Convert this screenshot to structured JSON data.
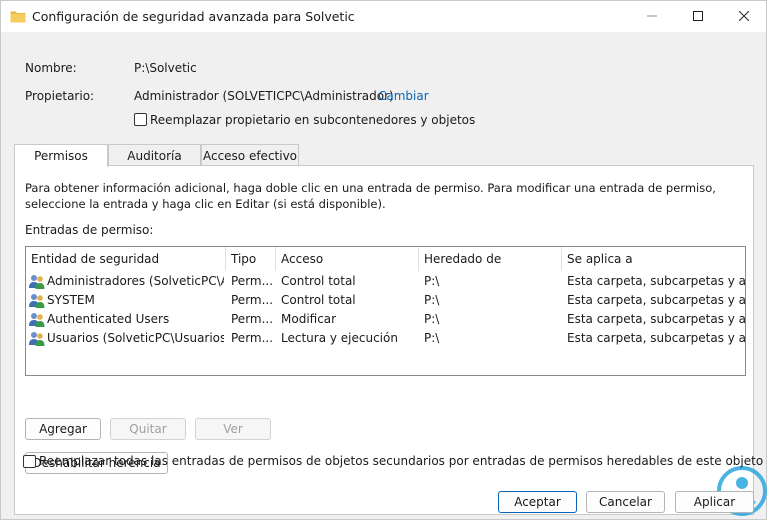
{
  "window": {
    "title": "Configuración de seguridad avanzada para Solvetic",
    "icon": "folder-icon",
    "controls": [
      "minimize-icon",
      "maximize-icon",
      "close-icon"
    ]
  },
  "header": {
    "name_label": "Nombre:",
    "name_value": "P:\\Solvetic",
    "owner_label": "Propietario:",
    "owner_value": "Administrador (SOLVETICPC\\Administrador)",
    "change_link": "Cambiar",
    "replace_owner_label": "Reemplazar propietario en subcontenedores y objetos"
  },
  "tabs": [
    {
      "label": "Permisos",
      "active": true
    },
    {
      "label": "Auditoría",
      "active": false
    },
    {
      "label": "Acceso efectivo",
      "active": false
    }
  ],
  "permisos": {
    "info": "Para obtener información adicional, haga doble clic en una entrada de permiso. Para modificar una entrada de permiso, seleccione la entrada y haga clic en Editar (si está disponible).",
    "entries_label": "Entradas de permiso:",
    "columns": [
      "Entidad de seguridad",
      "Tipo",
      "Acceso",
      "Heredado de",
      "Se aplica a"
    ],
    "rows": [
      {
        "entity": "Administradores (SolveticPC\\A...",
        "type": "Perm...",
        "access": "Control total",
        "inherited": "P:\\",
        "applies": "Esta carpeta, subcarpetas y arc..."
      },
      {
        "entity": "SYSTEM",
        "type": "Perm...",
        "access": "Control total",
        "inherited": "P:\\",
        "applies": "Esta carpeta, subcarpetas y arc..."
      },
      {
        "entity": "Authenticated Users",
        "type": "Perm...",
        "access": "Modificar",
        "inherited": "P:\\",
        "applies": "Esta carpeta, subcarpetas y arc..."
      },
      {
        "entity": "Usuarios (SolveticPC\\Usuarios)",
        "type": "Perm...",
        "access": "Lectura y ejecución",
        "inherited": "P:\\",
        "applies": "Esta carpeta, subcarpetas y arc..."
      }
    ],
    "buttons": {
      "add": "Agregar",
      "remove": "Quitar",
      "view": "Ver",
      "disable_inheritance": "Deshabilitar herencia"
    },
    "replace_all_label": "Reemplazar todas las entradas de permisos de objetos secundarios por entradas de permisos heredables de este objeto"
  },
  "footer": {
    "accept": "Aceptar",
    "cancel": "Cancelar",
    "apply": "Aplicar"
  },
  "watermark": {
    "brand": "Solvetic",
    "color": "#2aa6df"
  },
  "colors": {
    "link": "#0a64b4",
    "accent": "#0a64b4",
    "watermark": "#2aa6df"
  }
}
